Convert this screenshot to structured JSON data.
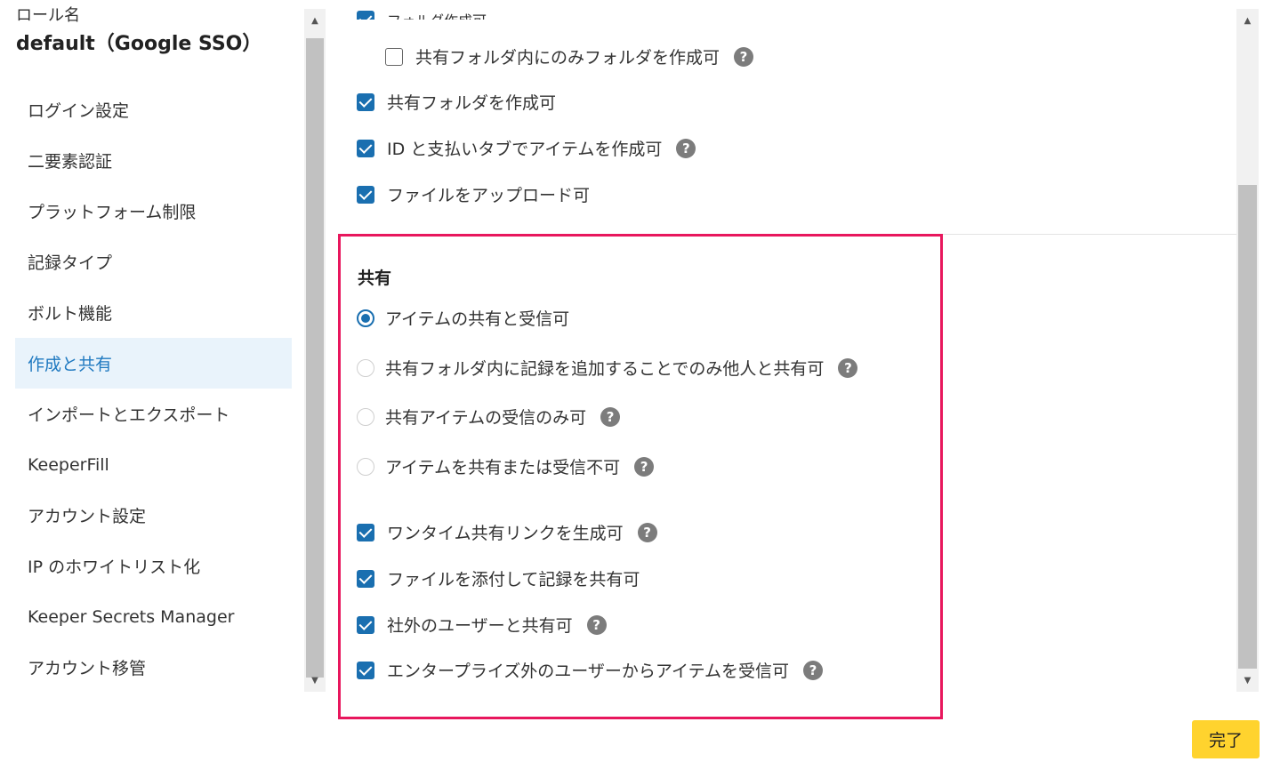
{
  "role": {
    "caption": "ロール名",
    "name": "default（Google SSO）"
  },
  "nav": {
    "items": [
      {
        "label": "ログイン設定"
      },
      {
        "label": "二要素認証"
      },
      {
        "label": "プラットフォーム制限"
      },
      {
        "label": "記録タイプ"
      },
      {
        "label": "ボルト機能"
      },
      {
        "label": "作成と共有",
        "active": true
      },
      {
        "label": "インポートとエクスポート"
      },
      {
        "label": "KeeperFill"
      },
      {
        "label": "アカウント設定"
      },
      {
        "label": "IP のホワイトリスト化"
      },
      {
        "label": "Keeper Secrets Manager"
      },
      {
        "label": "アカウント移管"
      }
    ]
  },
  "create": {
    "clipped_label": "フォルダ作成可",
    "shared_folder_only": {
      "label": "共有フォルダ内にのみフォルダを作成可",
      "checked": false
    },
    "create_shared_folder": {
      "label": "共有フォルダを作成可",
      "checked": true
    },
    "create_id_payment": {
      "label": "ID と支払いタブでアイテムを作成可",
      "checked": true
    },
    "upload_files": {
      "label": "ファイルをアップロード可",
      "checked": true
    }
  },
  "sharing": {
    "title": "共有",
    "radios": [
      {
        "label": "アイテムの共有と受信可",
        "selected": true
      },
      {
        "label": "共有フォルダ内に記録を追加することでのみ他人と共有可",
        "selected": false
      },
      {
        "label": "共有アイテムの受信のみ可",
        "selected": false
      },
      {
        "label": "アイテムを共有または受信不可",
        "selected": false
      }
    ],
    "checkboxes": [
      {
        "label": "ワンタイム共有リンクを生成可",
        "checked": true
      },
      {
        "label": "ファイルを添付して記録を共有可",
        "checked": true
      },
      {
        "label": "社外のユーザーと共有可",
        "checked": true
      },
      {
        "label": "エンタープライズ外のユーザーからアイテムを受信可",
        "checked": true
      }
    ]
  },
  "help_glyph": "?",
  "icons": {
    "checkbox": "checkmark-icon",
    "help": "question-circle-icon",
    "scroll_up": "triangle-up-icon",
    "scroll_down": "triangle-down-icon"
  },
  "colors": {
    "accent": "#1a6fb0",
    "active_nav_bg": "#e9f3fb",
    "highlight_border": "#e8175d",
    "done_button": "#ffd32e"
  },
  "footer": {
    "done_label": "完了"
  }
}
